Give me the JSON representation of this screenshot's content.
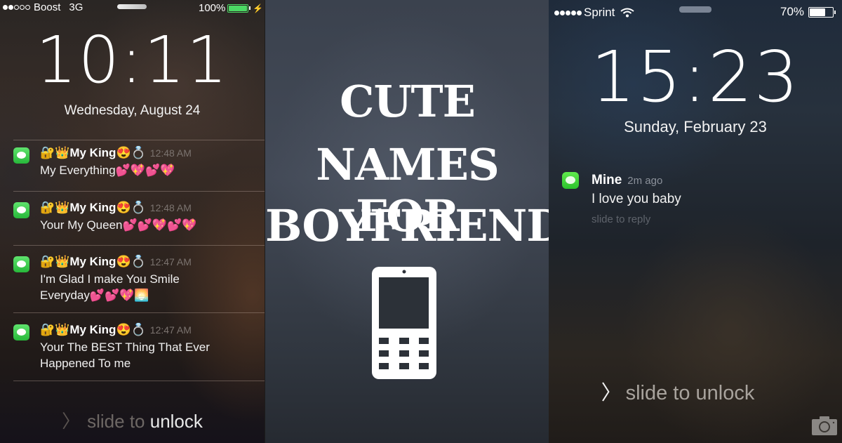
{
  "left_phone": {
    "status": {
      "carrier": "Boost",
      "network": "3G",
      "signal_bars_filled": 2,
      "signal_bars_total": 5,
      "battery": "100%",
      "battery_level": 1.0,
      "battery_color": "#4cd964",
      "charging_icon": "bolt-icon"
    },
    "time": "10:11",
    "date": "Wednesday, August 24",
    "notifications": [
      {
        "sender": "🔐👑My King😍💍",
        "time": "12:48 AM",
        "body": "My Everything💕💖💕💖"
      },
      {
        "sender": "🔐👑My King😍💍",
        "time": "12:48 AM",
        "body": "Your My Queen💕💕💖💕💖"
      },
      {
        "sender": "🔐👑My King😍💍",
        "time": "12:47 AM",
        "body": "I'm Glad I make You Smile Everyday💕💕💖🌅"
      },
      {
        "sender": "🔐👑My King😍💍",
        "time": "12:47 AM",
        "body": "Your The BEST Thing That Ever Happened To me"
      }
    ],
    "slide_prefix": "slide to ",
    "slide_highlight": "unlock"
  },
  "center": {
    "title_lines": [
      "CUTE",
      "NAMES FOR",
      "BOYFRIEND"
    ],
    "icon": "mobile-phone-icon"
  },
  "right_phone": {
    "status": {
      "carrier": "Sprint",
      "signal_bars_filled": 5,
      "signal_bars_total": 5,
      "wifi_icon": "wifi-icon",
      "battery": "70%",
      "battery_level": 0.7
    },
    "time": "15:23",
    "date": "Sunday, February 23",
    "notification": {
      "sender": "Mine",
      "time": "2m ago",
      "body": "I love you baby",
      "action": "slide to reply"
    },
    "slide_label": "slide to unlock",
    "camera_icon": "camera-icon"
  }
}
